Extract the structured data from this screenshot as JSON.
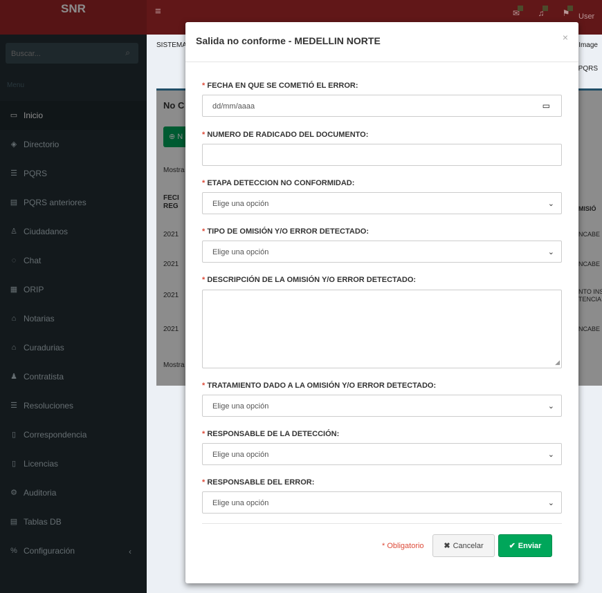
{
  "app": {
    "logo": "SNR",
    "user": "User"
  },
  "topbar": {
    "menu_icon": "hamburger-icon",
    "icons": [
      "mail-icon",
      "bell-icon",
      "flag-icon"
    ]
  },
  "sidebar": {
    "search_placeholder": "Buscar...",
    "menu_header": "Menu",
    "items": [
      {
        "label": "Inicio",
        "icon": "laptop-icon"
      },
      {
        "label": "Directorio",
        "icon": "users-icon"
      },
      {
        "label": "PQRS",
        "icon": "list-icon"
      },
      {
        "label": "PQRS anteriores",
        "icon": "card-icon"
      },
      {
        "label": "Ciudadanos",
        "icon": "male-icon"
      },
      {
        "label": "Chat",
        "icon": "chat-icon"
      },
      {
        "label": "ORIP",
        "icon": "building-icon"
      },
      {
        "label": "Notarias",
        "icon": "bank-icon"
      },
      {
        "label": "Curadurias",
        "icon": "home-icon"
      },
      {
        "label": "Contratista",
        "icon": "user-icon"
      },
      {
        "label": "Resoluciones",
        "icon": "list-icon"
      },
      {
        "label": "Correspondencia",
        "icon": "file-pdf-icon"
      },
      {
        "label": "Licencias",
        "icon": "file-icon"
      },
      {
        "label": "Auditoria",
        "icon": "cogs-icon"
      },
      {
        "label": "Tablas DB",
        "icon": "table-icon"
      },
      {
        "label": "Configuración",
        "icon": "wrench-icon"
      }
    ]
  },
  "background": {
    "crumb": "SISTEMA",
    "crumb_right": "PQRS",
    "image_label": "Image",
    "box_title": "No C",
    "add_button": "N",
    "showing_top": "Mostra",
    "showing_bottom": "Mostra",
    "table_head": [
      "FECI",
      "REG"
    ],
    "rows": [
      "2021",
      "2021",
      "2021",
      "2021"
    ],
    "right_head": "MISIÓ",
    "right_rows": [
      "NCABE",
      "NCABE",
      "NTO INS\nTENCIA",
      "NCABE"
    ]
  },
  "modal": {
    "title": "Salida no conforme - MEDELLIN NORTE",
    "close": "×",
    "fields": {
      "fecha_label": "FECHA EN QUE SE COMETIÓ EL ERROR:",
      "fecha_placeholder": "dd/mm/aaaa",
      "radicado_label": "NUMERO DE RADICADO DEL DOCUMENTO:",
      "radicado_value": "",
      "etapa_label": "ETAPA DETECCION NO CONFORMIDAD:",
      "etapa_value": "Elige una opción",
      "tipo_label": "TIPO DE OMISIÓN Y/O ERROR DETECTADO:",
      "tipo_value": "Elige una opción",
      "descripcion_label": "DESCRIPCIÓN DE LA OMISIÓN Y/O ERROR DETECTADO:",
      "descripcion_value": "",
      "tratamiento_label": "TRATAMIENTO DADO A LA OMISIÓN Y/O ERROR DETECTADO:",
      "tratamiento_value": "Elige una opción",
      "resp_deteccion_label": "RESPONSABLE DE LA DETECCIÓN:",
      "resp_deteccion_value": "Elige una opción",
      "resp_error_label": "RESPONSABLE DEL ERROR:",
      "resp_error_value": "Elige una opción"
    },
    "required_mark": "*",
    "required_note": "Obligatorio",
    "cancel_label": "Cancelar",
    "send_label": "Enviar"
  },
  "colors": {
    "accent": "#00a65a",
    "danger": "#dd4b39",
    "header": "#b02a2b",
    "sidebar": "#222d32"
  }
}
